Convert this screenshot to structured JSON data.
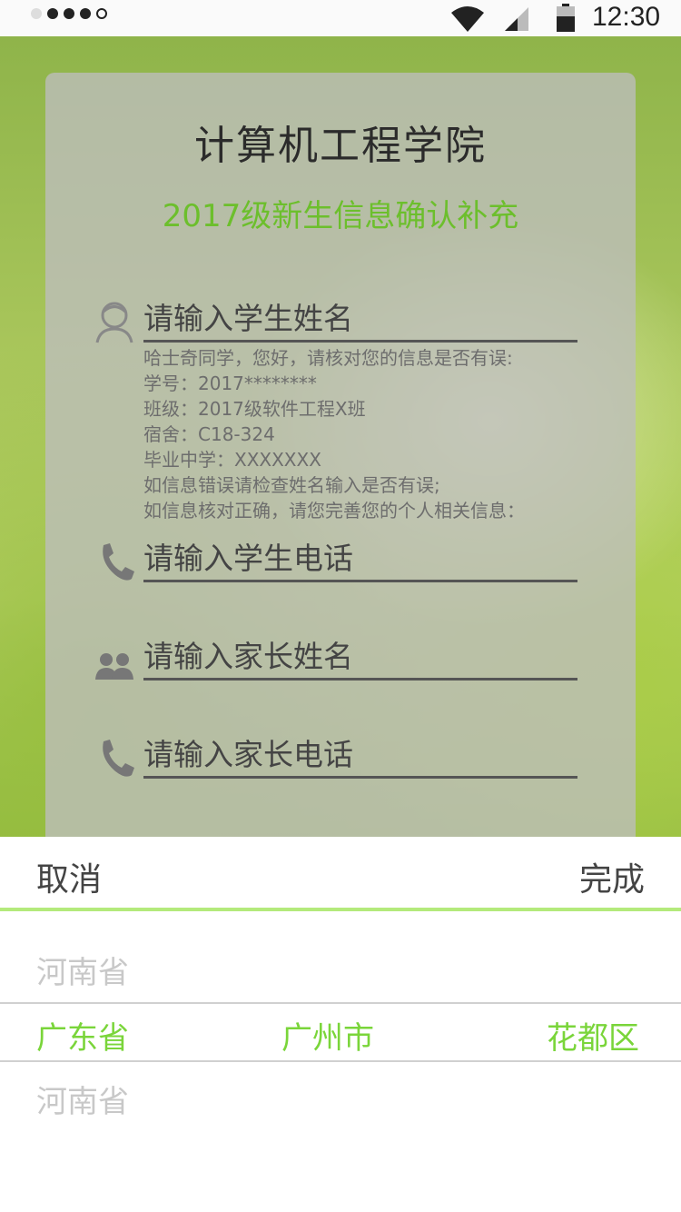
{
  "status_bar": {
    "time": "12:30"
  },
  "form": {
    "college": "计算机工程学院",
    "subtitle": "2017级新生信息确认补充",
    "student_name_placeholder": "请输入学生姓名",
    "student_phone_placeholder": "请输入学生电话",
    "parent_name_placeholder": "请输入家长姓名",
    "parent_phone_placeholder": "请输入家长电话",
    "info_lines": [
      "哈士奇同学，您好，请核对您的信息是否有误:",
      "学号：2017********",
      "班级：2017级软件工程X班",
      "宿舍：C18-324",
      "毕业中学：XXXXXXX",
      "如信息错误请检查姓名输入是否有误;",
      "如信息核对正确，请您完善您的个人相关信息："
    ]
  },
  "picker": {
    "cancel": "取消",
    "done": "完成",
    "above": "河南省",
    "below": "河南省",
    "selected": {
      "province": "广东省",
      "city": "广州市",
      "district": "花都区"
    },
    "accent_color": "#7ad53a"
  }
}
